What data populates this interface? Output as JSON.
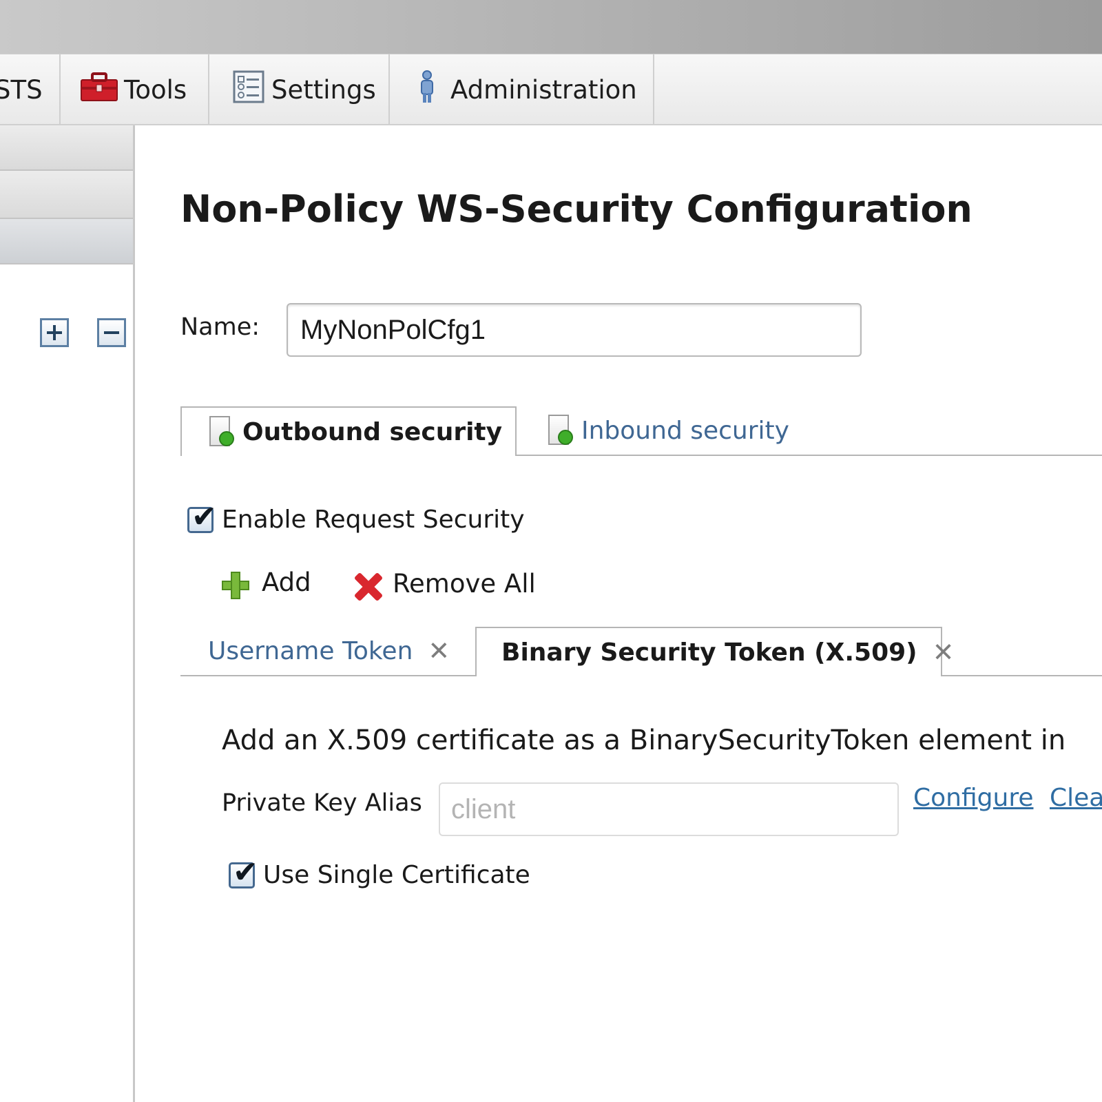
{
  "menubar": {
    "items": [
      {
        "label": "STS",
        "icon": ""
      },
      {
        "label": "Tools",
        "icon": "toolbox-icon"
      },
      {
        "label": "Settings",
        "icon": "settings-list-icon"
      },
      {
        "label": "Administration",
        "icon": "person-icon"
      }
    ]
  },
  "sidebar": {
    "expand_icon": "expand-all-icon",
    "collapse_icon": "collapse-all-icon"
  },
  "page": {
    "title": "Non-Policy WS-Security Configuration",
    "name_label": "Name:",
    "name_value": "MyNonPolCfg1"
  },
  "tabs": {
    "outbound": "Outbound security",
    "inbound": "Inbound security"
  },
  "outbound": {
    "enable_request_security": "Enable Request Security",
    "enable_request_security_checked": true,
    "add_label": "Add",
    "remove_all_label": "Remove All",
    "subtabs": {
      "username_token": "Username Token",
      "binary_security_token": "Binary Security Token (X.509)"
    },
    "bst": {
      "description": "Add an X.509 certificate as a BinarySecurityToken element in",
      "private_key_alias_label": "Private Key Alias",
      "private_key_alias_value": "client",
      "configure_link": "Configure",
      "clear_link": "Clea",
      "use_single_certificate": "Use Single Certificate",
      "use_single_certificate_checked": true
    }
  },
  "colors": {
    "link": "#2f6da3",
    "inactive_tab": "#3f6793",
    "remove_red": "#d9272e",
    "add_green": "#79b93b"
  }
}
